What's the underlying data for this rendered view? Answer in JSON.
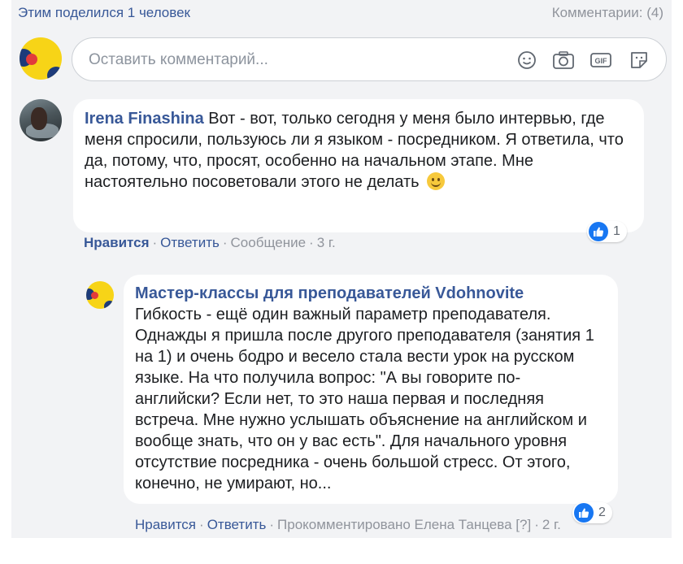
{
  "header": {
    "shared_text": "Этим поделился 1 человек",
    "comments_count": "Комментарии: (4)"
  },
  "composer": {
    "placeholder": "Оставить комментарий...",
    "icons": [
      "emoji-icon",
      "camera-icon",
      "gif-icon",
      "sticker-icon"
    ]
  },
  "comments": [
    {
      "author": "Irena Finashina",
      "text": "Вот - вот, только сегодня у меня было интервью, где меня спросили, пользуюсь ли я языком - посредником. Я ответила, что да, потому, что, просят, особенно на начальном этапе. Мне настоятельно посоветовали этого не делать",
      "reaction_count": "1",
      "actions": {
        "like": "Нравится",
        "reply": "Ответить",
        "message": "Сообщение",
        "time": "3 г."
      }
    },
    {
      "author": "Мастер-классы для преподавателей Vdohnovite",
      "text": "Гибкость - ещё один важный параметр преподавателя. Однажды я пришла после другого преподавателя (занятия 1 на 1) и очень бодро и весело стала вести урок на русском языке. На что получила вопрос: \"А вы говорите по-английски? Если нет, то это наша первая и последняя встреча. Мне нужно услышать объяснение на английском и вообще знать, что он у вас есть\". Для начального уровня отсутствие посредника - очень большой стресс. От этого, конечно, не умирают, но...",
      "reaction_count": "2",
      "actions": {
        "like": "Нравится",
        "reply": "Ответить",
        "commented_by": "Прокомментировано Елена Танцева [?]",
        "time": "2 г."
      }
    }
  ],
  "colors": {
    "link": "#385898",
    "muted": "#90949c",
    "like_blue": "#1877f2",
    "panel": "#f2f3f5",
    "brand_yellow": "#f7d417"
  }
}
